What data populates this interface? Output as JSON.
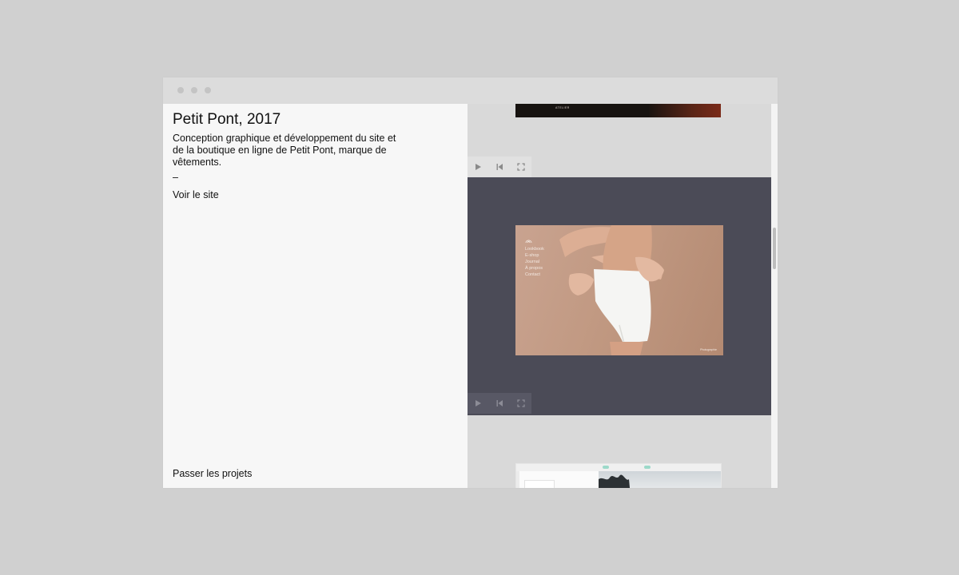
{
  "project": {
    "title": "Petit Pont, 2017",
    "description": "Conception graphique et développement du site et de la boutique en ligne de Petit Pont, marque de vêtements.",
    "separator": "–",
    "site_link": "Voir le site",
    "skip_link": "Passer les projets"
  },
  "preview": {
    "top_label": "ATELIER",
    "menu_items": [
      "Lookbook",
      "E-shop",
      "Journal",
      "À propos",
      "Contact"
    ],
    "credit": "Photographie"
  },
  "controls": {
    "icons": [
      "play-icon",
      "skip-back-icon",
      "fullscreen-icon"
    ]
  },
  "colors": {
    "page_bg": "#d0d0d0",
    "window_bg": "#f7f7f7",
    "titlebar": "#dcdcdc",
    "video_dark": "#4b4b57",
    "photo_tone": "#c19982"
  }
}
